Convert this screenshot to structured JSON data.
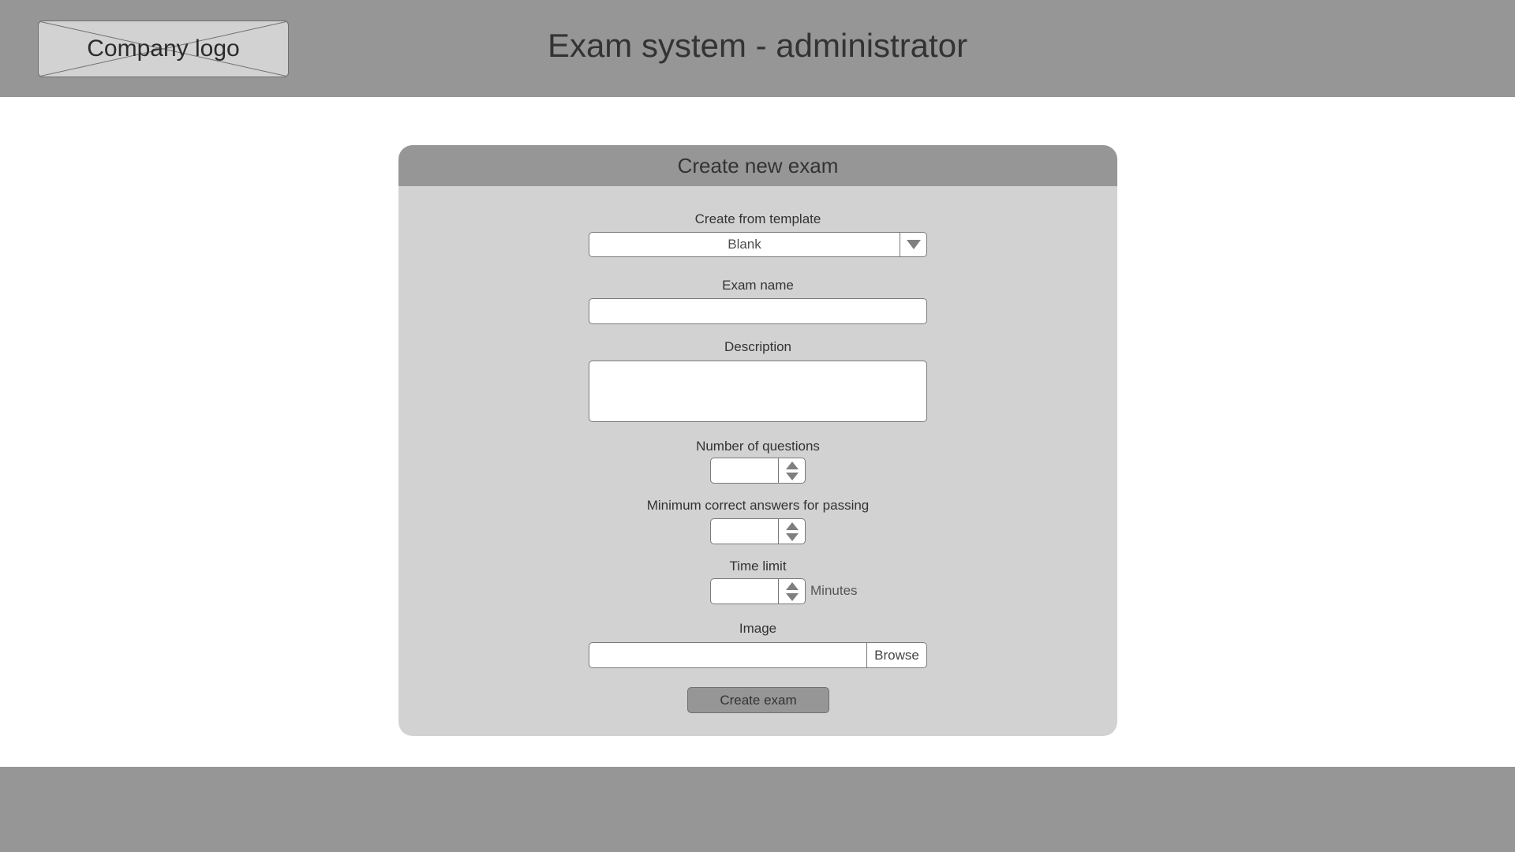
{
  "header": {
    "logo_text": "Company logo",
    "title": "Exam system - administrator"
  },
  "form": {
    "title": "Create new exam",
    "template": {
      "label": "Create from template",
      "selected": "Blank"
    },
    "exam_name": {
      "label": "Exam name",
      "value": ""
    },
    "description": {
      "label": "Description",
      "value": ""
    },
    "num_questions": {
      "label": "Number of questions",
      "value": ""
    },
    "min_correct": {
      "label": "Minimum correct answers for passing",
      "value": ""
    },
    "time_limit": {
      "label": "Time limit",
      "value": "",
      "unit": "Minutes"
    },
    "image": {
      "label": "Image",
      "value": "",
      "browse_label": "Browse"
    },
    "submit_label": "Create exam"
  },
  "colors": {
    "header_bg": "#969696",
    "card_bg": "#d2d2d2",
    "page_bg": "#ffffff"
  }
}
